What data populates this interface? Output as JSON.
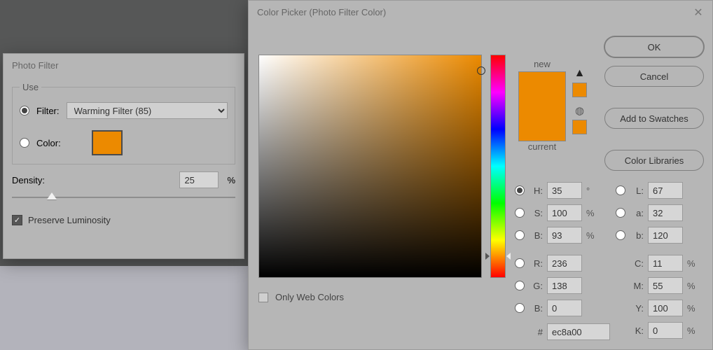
{
  "photo_filter": {
    "title": "Photo Filter",
    "use_legend": "Use",
    "filter_label": "Filter:",
    "filter_value": "Warming Filter (85)",
    "color_label": "Color:",
    "color_swatch": "#ec8a00",
    "density_label": "Density:",
    "density_value": "25",
    "density_unit": "%",
    "preserve_label": "Preserve Luminosity",
    "preserve_checked": true,
    "slider_percent": 25
  },
  "color_picker": {
    "title": "Color Picker (Photo Filter Color)",
    "buttons": {
      "ok": "OK",
      "cancel": "Cancel",
      "add_swatches": "Add to Swatches",
      "libraries": "Color Libraries"
    },
    "new_label": "new",
    "current_label": "current",
    "new_color": "#ec8a00",
    "current_color": "#ec8a00",
    "only_web_label": "Only Web Colors",
    "hsb": {
      "h": "35",
      "h_unit": "°",
      "s": "100",
      "s_unit": "%",
      "b": "93",
      "b_unit": "%"
    },
    "lab": {
      "l": "67",
      "a": "32",
      "b": "120"
    },
    "rgb": {
      "r": "236",
      "g": "138",
      "b": "0"
    },
    "cmyk": {
      "c": "11",
      "m": "55",
      "y": "100",
      "k": "0",
      "unit": "%"
    },
    "hex_prefix": "#",
    "hex": "ec8a00",
    "hue_percent_from_top": 90.3,
    "sv_x_pct": 100,
    "sv_y_pct": 7
  }
}
